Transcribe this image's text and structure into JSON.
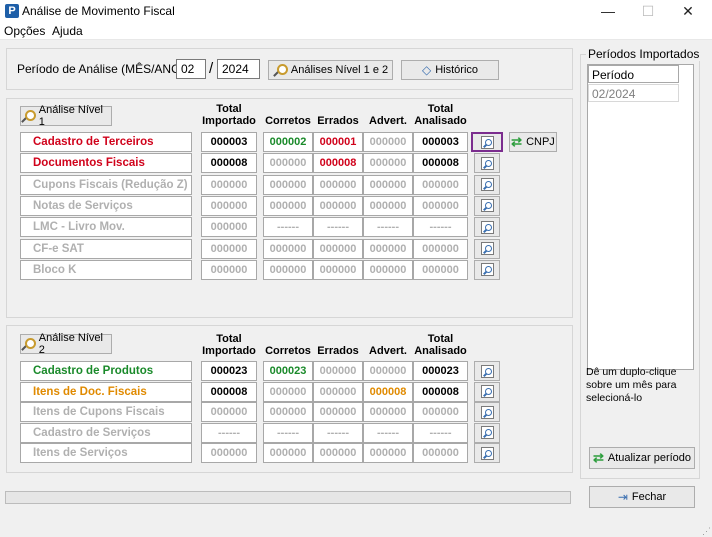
{
  "window": {
    "title": "Análise de Movimento Fiscal",
    "minimize": "—",
    "maximize": "☐",
    "close": "✕"
  },
  "menu": [
    "Opções",
    "Ajuda"
  ],
  "period": {
    "label": "Período de Análise (MÊS/ANO):",
    "month": "02",
    "separator": "/",
    "year": "2024",
    "btn_levels": "Análises Nível 1 e 2",
    "btn_history": "Histórico"
  },
  "headers": {
    "total_importado": [
      "Total",
      "Importado"
    ],
    "corretos": "Corretos",
    "errados": "Errados",
    "advert": "Advert.",
    "total_analisado": [
      "Total",
      "Analisado"
    ]
  },
  "level1": {
    "button": "Análise Nível 1",
    "cnpj": "CNPJ",
    "rows": [
      {
        "label": "Cadastro de Terceiros",
        "color": "#d0021b",
        "total": "000003",
        "corretos": "000002",
        "errados": "000001",
        "advert": "000000",
        "analisado": "000003",
        "active": true
      },
      {
        "label": "Documentos Fiscais",
        "color": "#d0021b",
        "total": "000008",
        "corretos": "000000",
        "errados": "000008",
        "advert": "000000",
        "analisado": "000008",
        "active": true
      },
      {
        "label": "Cupons Fiscais (Redução Z)",
        "color": "#b0b0b0",
        "total": "000000",
        "corretos": "000000",
        "errados": "000000",
        "advert": "000000",
        "analisado": "000000",
        "active": false
      },
      {
        "label": "Notas de Serviços",
        "color": "#b0b0b0",
        "total": "000000",
        "corretos": "000000",
        "errados": "000000",
        "advert": "000000",
        "analisado": "000000",
        "active": false
      },
      {
        "label": "LMC - Livro Mov. Combustíveis",
        "color": "#b0b0b0",
        "total": "000000",
        "corretos": "------",
        "errados": "------",
        "advert": "------",
        "analisado": "------",
        "active": false
      },
      {
        "label": "CF-e SAT",
        "color": "#b0b0b0",
        "total": "000000",
        "corretos": "000000",
        "errados": "000000",
        "advert": "000000",
        "analisado": "000000",
        "active": false
      },
      {
        "label": "Bloco K",
        "color": "#b0b0b0",
        "total": "000000",
        "corretos": "000000",
        "errados": "000000",
        "advert": "000000",
        "analisado": "000000",
        "active": false
      }
    ]
  },
  "level2": {
    "button": "Análise Nível 2",
    "rows": [
      {
        "label": "Cadastro de Produtos",
        "color": "#1a8a2a",
        "total": "000023",
        "corretos": "000023",
        "errados": "000000",
        "advert": "000000",
        "analisado": "000023",
        "active": true
      },
      {
        "label": "Itens de Doc. Fiscais",
        "color": "#e08a00",
        "total": "000008",
        "corretos": "000000",
        "errados": "000000",
        "advert": "000008",
        "analisado": "000008",
        "active": true
      },
      {
        "label": "Itens de Cupons Fiscais",
        "color": "#b0b0b0",
        "total": "000000",
        "corretos": "000000",
        "errados": "000000",
        "advert": "000000",
        "analisado": "000000",
        "active": false
      },
      {
        "label": "Cadastro de Serviços",
        "color": "#b0b0b0",
        "total": "------",
        "corretos": "------",
        "errados": "------",
        "advert": "------",
        "analisado": "------",
        "active": false
      },
      {
        "label": "Itens de Serviços",
        "color": "#b0b0b0",
        "total": "000000",
        "corretos": "000000",
        "errados": "000000",
        "advert": "000000",
        "analisado": "000000",
        "active": false
      }
    ]
  },
  "right": {
    "title": "Períodos Importados",
    "col": "Período",
    "items": [
      "02/2024"
    ],
    "hint": "Dê um duplo-clique sobre um mês para selecioná-lo",
    "update_btn": "Atualizar período",
    "close_btn": "Fechar"
  },
  "colors": {
    "green": "#1a8a2a",
    "red": "#d0021b",
    "orange": "#e08a00",
    "highlight": "#7b2d8e"
  }
}
